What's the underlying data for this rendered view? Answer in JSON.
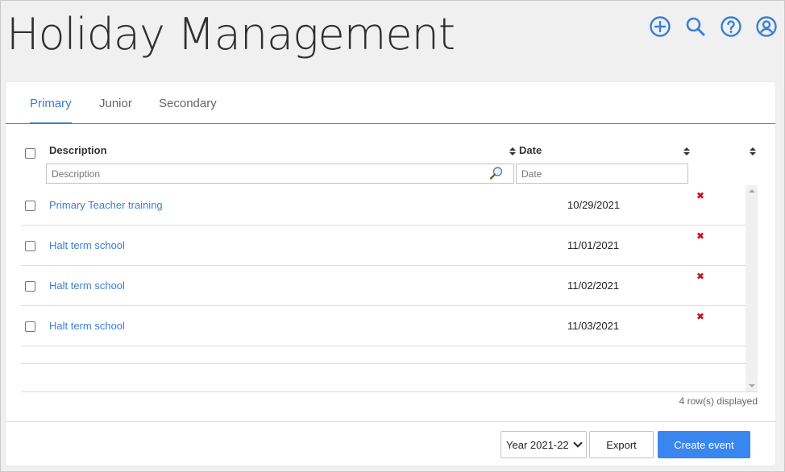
{
  "page": {
    "title": "Holiday Management"
  },
  "header_icons": [
    "plus-circle-icon",
    "search-icon",
    "help-circle-icon",
    "user-circle-icon"
  ],
  "colors": {
    "accent": "#3a7fd5",
    "primary_button": "#3a86f0",
    "delete": "#c0141a"
  },
  "tabs": [
    {
      "label": "Primary",
      "active": true
    },
    {
      "label": "Junior",
      "active": false
    },
    {
      "label": "Secondary",
      "active": false
    }
  ],
  "table": {
    "columns": {
      "description": "Description",
      "date": "Date"
    },
    "filters": {
      "description_placeholder": "Description",
      "date_placeholder": "Date"
    },
    "rows": [
      {
        "description": "Primary Teacher training",
        "date": "10/29/2021",
        "delete": "✖"
      },
      {
        "description": "Halt term school",
        "date": "11/01/2021",
        "delete": "✖"
      },
      {
        "description": "Halt term school",
        "date": "11/02/2021",
        "delete": "✖"
      },
      {
        "description": "Halt term school",
        "date": "11/03/2021",
        "delete": "✖"
      }
    ],
    "rows_displayed": "4 row(s) displayed"
  },
  "footer": {
    "year_select": "Year 2021-22",
    "export_label": "Export",
    "create_label": "Create event"
  }
}
